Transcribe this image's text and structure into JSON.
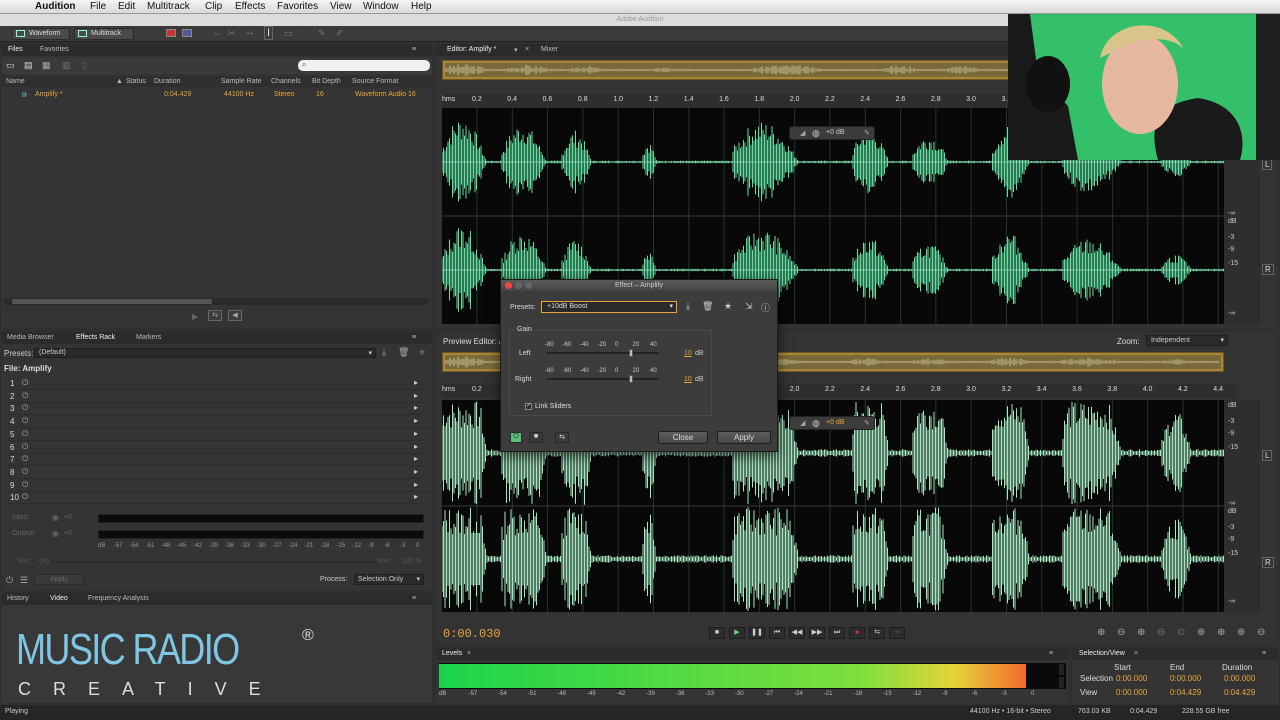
{
  "menubar": {
    "apple": "",
    "app": "Audition",
    "items": [
      "File",
      "Edit",
      "Multitrack",
      "Clip",
      "Effects",
      "Favorites",
      "View",
      "Window",
      "Help"
    ]
  },
  "window_title": "Adobe Audition",
  "toolbar": {
    "waveform": "Waveform",
    "multitrack": "Multitrack"
  },
  "files_panel": {
    "tabs": [
      "Files",
      "Favorites"
    ],
    "columns": [
      "Name",
      "Status",
      "Duration",
      "Sample Rate",
      "Channels",
      "Bit Depth",
      "Source Format"
    ],
    "row": {
      "name": "Amplify *",
      "duration": "0:04.429",
      "sample_rate": "44100 Hz",
      "channels": "Stereo",
      "bit_depth": "16",
      "format": "Waveform Audio 16"
    }
  },
  "effects_panel": {
    "tabs": [
      "Media Browser",
      "Effects Rack",
      "Markers"
    ],
    "presets_label": "Presets:",
    "presets_value": "(Default)",
    "file_label": "File: Amplify",
    "rows": [
      "1",
      "2",
      "3",
      "4",
      "5",
      "6",
      "7",
      "8",
      "9",
      "10"
    ],
    "input_label": "Input:",
    "output_label": "Output:",
    "io_value": "+0",
    "meter_scale": [
      "dB",
      "-57",
      "-54",
      "-51",
      "-48",
      "-45",
      "-42",
      "-39",
      "-36",
      "-33",
      "-30",
      "-27",
      "-24",
      "-21",
      "-18",
      "-15",
      "-12",
      "-9",
      "-6",
      "-3",
      "0"
    ],
    "mix_label": "Mix:",
    "dry_label": "Dry",
    "wet_label": "Wet",
    "wet_value": "100 %",
    "apply_label": "Apply",
    "process_label": "Process:",
    "process_value": "Selection Only"
  },
  "history_panel": {
    "tabs": [
      "History",
      "Video",
      "Frequency Analysis"
    ]
  },
  "logo": {
    "line1": "MUSIC RADIO",
    "registered": "®",
    "line2": "CREATIVE"
  },
  "editor": {
    "tab": "Editor: Amplify *",
    "mixer": "Mixer",
    "hms": "hms",
    "ruler": [
      "0.2",
      "0.4",
      "0.6",
      "0.8",
      "1.0",
      "1.2",
      "1.4",
      "1.6",
      "1.8",
      "2.0",
      "2.2",
      "2.4",
      "2.6",
      "2.8",
      "3.0",
      "3.2",
      "3.4",
      "3.6",
      "3.8",
      "4.0",
      "4.2",
      "4.4"
    ],
    "hud_value": "+0 dB",
    "db_scale": [
      "dB",
      "-3",
      "-9",
      "-15",
      "-∞",
      "-15",
      "-9",
      "-3"
    ],
    "preview_title": "Preview Editor: A",
    "zoom_label": "Zoom:",
    "zoom_value": "Independent",
    "time": "0:00.030",
    "channel_l": "L",
    "channel_r": "R"
  },
  "effect_dialog": {
    "title": "Effect – Amplify",
    "presets_label": "Presets:",
    "presets_value": "+10dB Boost",
    "gain_label": "Gain",
    "left_label": "Left",
    "right_label": "Right",
    "slider_scale": [
      "-80",
      "-60",
      "-40",
      "-20",
      "0",
      "20",
      "40"
    ],
    "left_value": "10",
    "right_value": "10",
    "unit": "dB",
    "link_label": "Link Sliders",
    "close": "Close",
    "apply": "Apply"
  },
  "levels": {
    "tab": "Levels",
    "scale": [
      "dB",
      "-57",
      "-54",
      "-51",
      "-48",
      "-45",
      "-42",
      "-39",
      "-36",
      "-33",
      "-30",
      "-27",
      "-24",
      "-21",
      "-18",
      "-15",
      "-12",
      "-9",
      "-6",
      "-3",
      "0"
    ],
    "level": 0.95
  },
  "selection_view": {
    "tab": "Selection/View",
    "headers": [
      "Start",
      "End",
      "Duration"
    ],
    "selection_label": "Selection",
    "view_label": "View",
    "selection": [
      "0:00.000",
      "0:00.000",
      "0:00.000"
    ],
    "view": [
      "0:00.000",
      "0:04.429",
      "0:04.429"
    ]
  },
  "statusbar": {
    "state": "Playing",
    "format": "44100 Hz • 16-bit • Stereo",
    "size": "763.03 KB",
    "duration": "0:04.429",
    "free": "228.55 GB free"
  },
  "colors": {
    "waveform": "#5fe0a0",
    "accent": "#e6a73a",
    "green_screen": "#34c06a"
  }
}
